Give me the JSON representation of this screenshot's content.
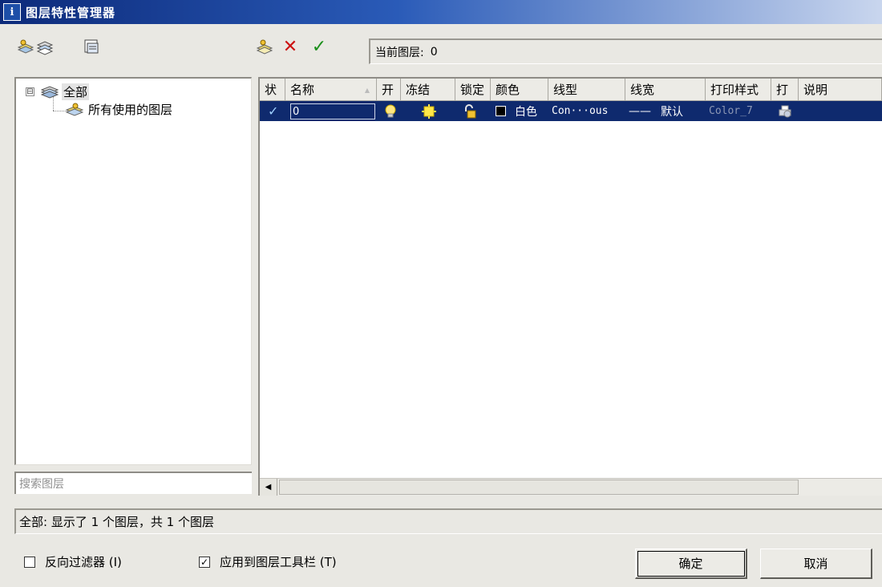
{
  "window": {
    "title": "图层特性管理器",
    "icon": "app-icon",
    "icon_glyph": "i"
  },
  "toolbar_left": [
    {
      "name": "new-property-filter-icon",
      "label": ""
    },
    {
      "name": "new-group-filter-icon",
      "label": ""
    },
    {
      "name": "layer-states-manager-icon",
      "label": ""
    }
  ],
  "toolbar_right": [
    {
      "name": "new-layer-icon"
    },
    {
      "name": "delete-layer-icon",
      "glyph": "✕",
      "color": "#cc1111"
    },
    {
      "name": "set-current-icon",
      "glyph": "✓",
      "color": "#1a8f1a"
    }
  ],
  "current_layer": {
    "label": "当前图层:",
    "value": "0"
  },
  "tree": {
    "root": {
      "label": "全部",
      "expander": "⊟"
    },
    "child": {
      "label": "所有使用的图层"
    }
  },
  "search": {
    "placeholder": "搜索图层"
  },
  "grid": {
    "columns": [
      "状",
      "名称",
      "开",
      "冻结",
      "锁定",
      "颜色",
      "线型",
      "线宽",
      "打印样式",
      "打",
      "说明"
    ],
    "rows": [
      {
        "status_glyph": "✓",
        "name": "0",
        "on_icon": "lightbulb-icon",
        "freeze_icon": "sun-icon",
        "lock_icon": "unlock-icon",
        "color_swatch": "#000000",
        "color": "白色",
        "linetype": "Con···ous",
        "lineweight_line": "——",
        "lineweight": "默认",
        "plot_style": "Color_7",
        "plot_icon": "printer-icon",
        "description": ""
      }
    ],
    "row_selected_color": "#0f2a6e"
  },
  "status_bar": {
    "text": "全部: 显示了 1 个图层，共 1 个图层"
  },
  "options": {
    "invert_filter": {
      "label": "反向过滤器 (I)",
      "checked": false,
      "check_glyph": ""
    },
    "apply_to_toolbar": {
      "label": "应用到图层工具栏 (T)",
      "checked": true,
      "check_glyph": "✓"
    }
  },
  "buttons": {
    "ok": "确定",
    "cancel": "取消"
  },
  "colors": {
    "dialog_bg": "#e9e8e3",
    "title_bar": "#0c2a7a",
    "selection": "#0f2a6e"
  }
}
